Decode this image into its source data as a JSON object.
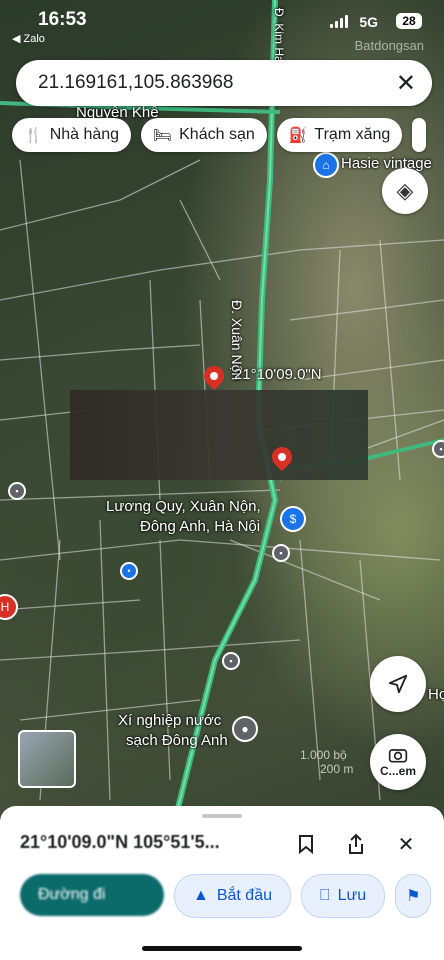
{
  "status_bar": {
    "time": "16:53",
    "back_app": "◀ Zalo",
    "network": "5G",
    "battery": "28",
    "watermark": "Batdongsan"
  },
  "search": {
    "value": "21.169161,105.863968"
  },
  "chips": [
    {
      "icon": "fork-knife-icon",
      "label": "Nhà hàng"
    },
    {
      "icon": "bed-icon",
      "label": "Khách sạn"
    },
    {
      "icon": "gas-station-icon",
      "label": "Trạm xăng"
    }
  ],
  "map": {
    "road_labels": {
      "top_street": "Nguyễn Khê",
      "road_vertical": "Đ. Xuân Nộn",
      "top_right_road": "Đ. Kim Ha"
    },
    "pin_label": "21°10'09.0\"N",
    "places": {
      "hasie": "Hasie vintage",
      "luong_quy_line1": "Lương Quy, Xuân Nộn,",
      "luong_quy_line2": "Đông Anh, Hà Nội",
      "xi_nghiep_line1": "Xí nghiệp nước",
      "xi_nghiep_line2": "sạch Đông Anh",
      "ho": "Họ"
    },
    "scale": {
      "top": "1.000 bộ",
      "bottom": "200 m"
    },
    "camera_label": "C...em"
  },
  "sheet": {
    "title": "21°10'09.0\"N 105°51'5...",
    "actions": {
      "directions": "Đường đi",
      "start": "Bắt đầu",
      "save": "Lưu"
    }
  }
}
